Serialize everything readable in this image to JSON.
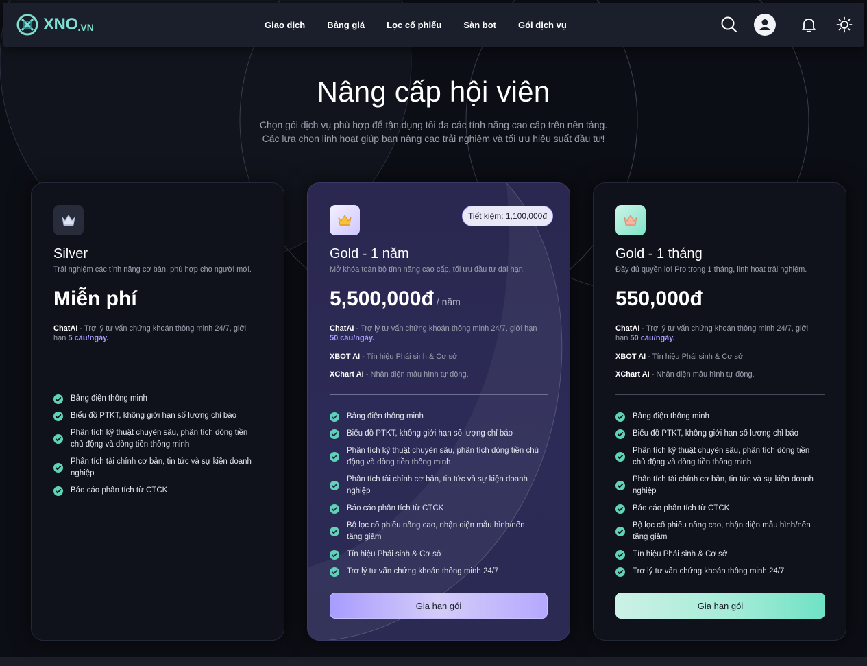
{
  "brand": {
    "name": "XNO",
    "suffix": ".VN"
  },
  "nav": [
    "Giao dịch",
    "Bảng giá",
    "Lọc cổ phiếu",
    "Sàn bot",
    "Gói dịch vụ"
  ],
  "hero": {
    "title": "Nâng cấp hội viên",
    "subtitle_line1": "Chọn gói dịch vụ phù hợp để tận dụng tối đa các tính năng cao cấp trên nền tảng.",
    "subtitle_line2": "Các lựa chọn linh hoạt giúp bạn nâng cao trải nghiệm và tối ưu hiệu suất đầu tư!"
  },
  "colors": {
    "accent_purple": "#a79cff",
    "accent_green": "#6fe2c4",
    "check_green": "#5fd3b8",
    "background": "#0c0e15"
  },
  "icons": {
    "search": "search-icon",
    "user": "user-icon",
    "bell": "bell-icon",
    "theme": "sun-icon"
  },
  "plans": {
    "silver": {
      "name": "Silver",
      "desc": "Trải nghiệm các tính năng cơ bản, phù hợp cho người mới.",
      "price": "Miễn phí",
      "chatai_label": "ChatAI",
      "chatai_text": " - Trợ lý tư vấn chứng khoán thông minh 24/7, giới",
      "chatai_text2": "hạn ",
      "chatai_limit": "5 câu/ngày.",
      "features": [
        "Bảng điện thông minh",
        "Biểu đồ PTKT, không giới hạn số lượng chỉ báo",
        "Phân tích kỹ thuật chuyên sâu, phân tích dòng tiền chủ động và dòng tiền thông minh",
        "Phân tích tài chính cơ bản, tin tức và sự kiện doanh nghiệp",
        "Báo cáo phân tích từ CTCK"
      ]
    },
    "gold_year": {
      "name": "Gold - 1 năm",
      "desc": "Mở khóa toàn bộ tính năng cao cấp, tối ưu đầu tư dài hạn.",
      "price": "5,500,000đ",
      "period": "/ năm",
      "badge": "Tiết kiệm: 1,100,000đ",
      "chatai_label": "ChatAI",
      "chatai_text": " - Trợ lý tư vấn chứng khoán thông minh 24/7, giới hạn",
      "chatai_limit": "50 câu/ngày.",
      "xbot_label": "XBOT AI",
      "xbot_text": " - Tín hiệu Phái sinh & Cơ sở",
      "xchart_label": "XChart AI",
      "xchart_text": " - Nhận diện mẫu hình tự động.",
      "features": [
        "Bảng điện thông minh",
        "Biểu đồ PTKT, không giới hạn số lượng chỉ báo",
        "Phân tích kỹ thuật chuyên sâu, phân tích dòng tiền chủ động và dòng tiền thông minh",
        "Phân tích tài chính cơ bản, tin tức và sự kiện doanh nghiệp",
        "Báo cáo phân tích từ CTCK",
        "Bộ lọc cổ phiếu nâng cao, nhận diện mẫu hình/nến tăng giảm",
        "Tín hiệu Phái sinh & Cơ sở",
        "Trợ lý tư vấn chứng khoán thông minh 24/7"
      ],
      "cta": "Gia hạn gói"
    },
    "gold_month": {
      "name": "Gold - 1 tháng",
      "desc": "Đầy đủ quyền lợi Pro trong 1 tháng, linh hoạt trải nghiệm.",
      "price": "550,000đ",
      "chatai_label": "ChatAI",
      "chatai_text": " - Trợ lý tư vấn chứng khoán thông minh 24/7, giới",
      "chatai_text2": "hạn ",
      "chatai_limit": "50 câu/ngày.",
      "xbot_label": "XBOT AI",
      "xbot_text": " - Tín hiệu Phái sinh & Cơ sở",
      "xchart_label": "XChart AI",
      "xchart_text": " - Nhận diện mẫu hình tự động.",
      "features": [
        "Bảng điện thông minh",
        "Biểu đồ PTKT, không giới hạn số lượng chỉ báo",
        "Phân tích kỹ thuật chuyên sâu, phân tích dòng tiền chủ động và dòng tiền thông minh",
        "Phân tích tài chính cơ bản, tin tức và sự kiện doanh nghiệp",
        "Báo cáo phân tích từ CTCK",
        "Bộ lọc cổ phiếu nâng cao, nhận diện mẫu hình/nến tăng giảm",
        "Tín hiệu Phái sinh & Cơ sở",
        "Trợ lý tư vấn chứng khoán thông minh 24/7"
      ],
      "cta": "Gia hạn gói"
    }
  }
}
